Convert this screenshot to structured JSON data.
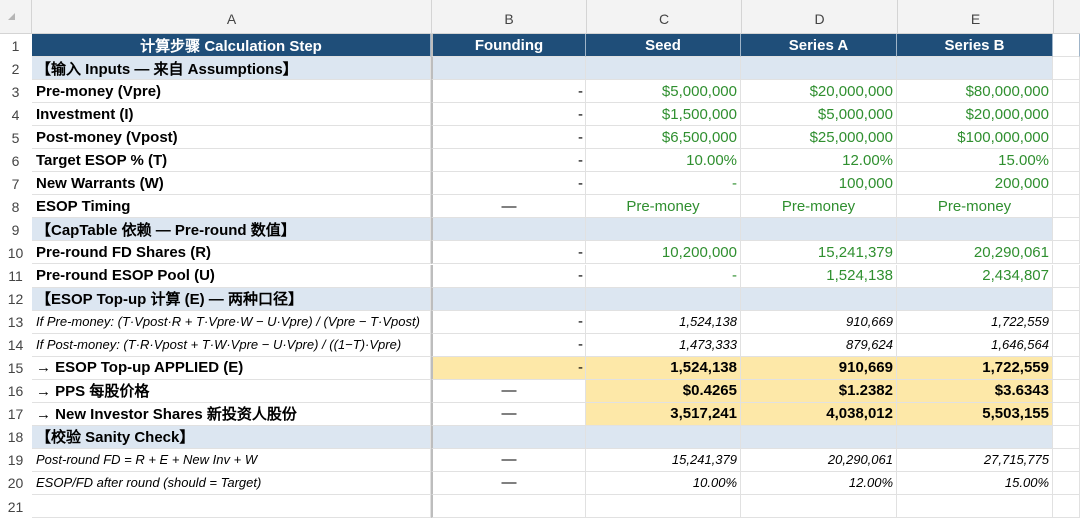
{
  "columns": [
    "A",
    "B",
    "C",
    "D",
    "E"
  ],
  "header": {
    "label": "计算步骤 Calculation Step",
    "b": "Founding",
    "c": "Seed",
    "d": "Series A",
    "e": "Series B"
  },
  "rows": [
    {
      "n": "2",
      "type": "section",
      "label": "【输入 Inputs — 来自 Assumptions】",
      "b": "",
      "c": "",
      "d": "",
      "e": ""
    },
    {
      "n": "3",
      "type": "bold-green",
      "label": "Pre-money (Vpre)",
      "b": "-",
      "c": "$5,000,000",
      "d": "$20,000,000",
      "e": "$80,000,000"
    },
    {
      "n": "4",
      "type": "bold-green",
      "label": "Investment (I)",
      "b": "-",
      "c": "$1,500,000",
      "d": "$5,000,000",
      "e": "$20,000,000"
    },
    {
      "n": "5",
      "type": "bold-green",
      "label": "Post-money (Vpost)",
      "b": "-",
      "c": "$6,500,000",
      "d": "$25,000,000",
      "e": "$100,000,000"
    },
    {
      "n": "6",
      "type": "bold-green",
      "label": "Target ESOP % (T)",
      "b": "-",
      "c": "10.00%",
      "d": "12.00%",
      "e": "15.00%"
    },
    {
      "n": "7",
      "type": "bold-green",
      "label": "New Warrants (W)",
      "b": "-",
      "c": "-",
      "d": "100,000",
      "e": "200,000"
    },
    {
      "n": "8",
      "type": "bold-green-center",
      "label": "ESOP Timing",
      "b": "—",
      "c": "Pre-money",
      "d": "Pre-money",
      "e": "Pre-money"
    },
    {
      "n": "9",
      "type": "section",
      "label": "【CapTable 依赖 — Pre-round 数值】",
      "b": "",
      "c": "",
      "d": "",
      "e": ""
    },
    {
      "n": "10",
      "type": "bold-green",
      "label": "Pre-round FD Shares (R)",
      "b": "-",
      "c": "10,200,000",
      "d": "15,241,379",
      "e": "20,290,061"
    },
    {
      "n": "11",
      "type": "bold-green",
      "label": "Pre-round ESOP Pool (U)",
      "b": "-",
      "c": "-",
      "d": "1,524,138",
      "e": "2,434,807"
    },
    {
      "n": "12",
      "type": "section",
      "label": "【ESOP Top-up 计算 (E) — 两种口径】",
      "b": "",
      "c": "",
      "d": "",
      "e": ""
    },
    {
      "n": "13",
      "type": "italic",
      "label": "If Pre-money: (T·Vpost·R + T·Vpre·W − U·Vpre) / (Vpre − T·Vpost)",
      "b": "-",
      "c": "1,524,138",
      "d": "910,669",
      "e": "1,722,559"
    },
    {
      "n": "14",
      "type": "italic",
      "label": "If Post-money: (T·R·Vpost + T·W·Vpre − U·Vpre) / ((1−T)·Vpre)",
      "b": "-",
      "c": "1,473,333",
      "d": "879,624",
      "e": "1,646,564"
    },
    {
      "n": "15",
      "type": "bold-hl",
      "label": "→ ESOP Top-up APPLIED (E)",
      "b": "-",
      "c": "1,524,138",
      "d": "910,669",
      "e": "1,722,559"
    },
    {
      "n": "16",
      "type": "bold-hl2",
      "label": "→ PPS 每股价格",
      "b": "—",
      "c": "$0.4265",
      "d": "$1.2382",
      "e": "$3.6343"
    },
    {
      "n": "17",
      "type": "bold-hl2",
      "label": "→ New Investor Shares 新投资人股份",
      "b": "—",
      "c": "3,517,241",
      "d": "4,038,012",
      "e": "5,503,155"
    },
    {
      "n": "18",
      "type": "section",
      "label": "【校验 Sanity Check】",
      "b": "",
      "c": "",
      "d": "",
      "e": ""
    },
    {
      "n": "19",
      "type": "italic",
      "label": "Post-round FD = R + E + New Inv + W",
      "b": "—",
      "c": "15,241,379",
      "d": "20,290,061",
      "e": "27,715,775"
    },
    {
      "n": "20",
      "type": "italic",
      "label": "ESOP/FD after round (should = Target)",
      "b": "—",
      "c": "10.00%",
      "d": "12.00%",
      "e": "15.00%"
    },
    {
      "n": "21",
      "type": "empty",
      "label": "",
      "b": "",
      "c": "",
      "d": "",
      "e": ""
    }
  ]
}
